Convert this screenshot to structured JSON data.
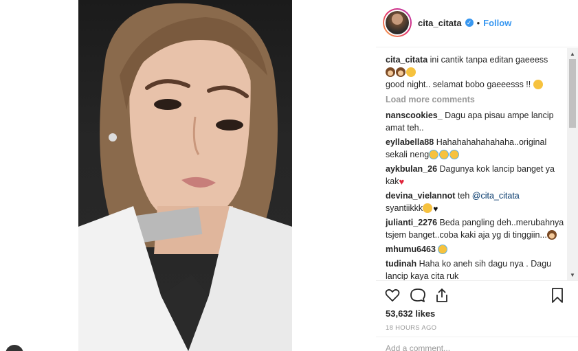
{
  "post": {
    "username": "cita_citata",
    "follow_label": "Follow",
    "separator": "•",
    "verified_glyph": "✓",
    "likes": "53,632 likes",
    "time": "18 HOURS AGO",
    "comment_placeholder": "Add a comment..."
  },
  "caption": {
    "username": "cita_citata",
    "text_1": "ini cantik tanpa editan gaeeess",
    "text_2": "good night.. selamat bobo gaeeesss !!"
  },
  "load_more": "Load more comments",
  "comments": [
    {
      "user": "nanscookies_",
      "text": "Dagu apa pisau ampe lancip amat teh.."
    },
    {
      "user": "eyllabella88",
      "text": "Hahahahahahahaha..original sekali neng"
    },
    {
      "user": "aykbulan_26",
      "text": "Dagunya kok lancip banget ya kak"
    },
    {
      "user": "devina_vielannot",
      "text_pre": "teh ",
      "mention": "@cita_citata",
      "text_post": "syantiikkk"
    },
    {
      "user": "julianti_2276",
      "text": "Beda pangling deh..merubahnya tsjem banget..coba kaki aja yg di tinggiin..."
    },
    {
      "user": "mhumu6463",
      "text": ""
    },
    {
      "user": "tudinah",
      "text": "Haha ko aneh sih dagu nya . Dagu lancip kaya cita ruk"
    }
  ],
  "icons": {
    "like": "heart-icon",
    "comment": "comment-icon",
    "share": "share-icon",
    "save": "bookmark-icon"
  },
  "colors": {
    "link": "#3897f0",
    "text": "#262626",
    "muted": "#999999"
  }
}
